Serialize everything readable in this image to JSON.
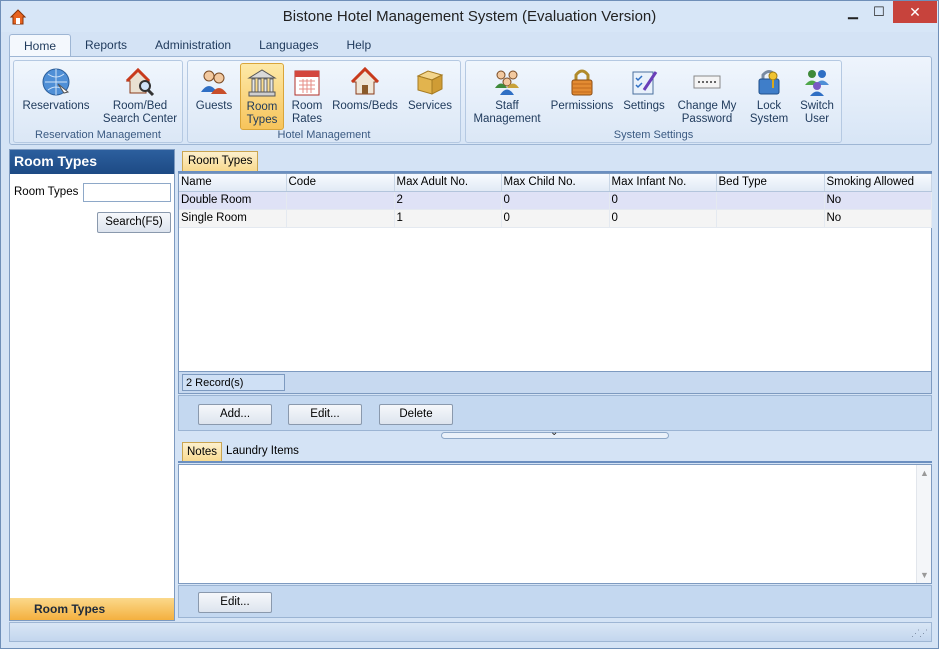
{
  "window": {
    "title": "Bistone Hotel Management System (Evaluation Version)",
    "minimize": "▁",
    "maximize": "☐",
    "close": "✕"
  },
  "ribbon": {
    "tabs": [
      "Home",
      "Reports",
      "Administration",
      "Languages",
      "Help"
    ],
    "groups": {
      "reservation": {
        "label": "Reservation Management",
        "buttons": [
          {
            "label": "Reservations",
            "icon": "globe-icon"
          },
          {
            "label": "Room/Bed Search Center",
            "icon": "house-search-icon"
          }
        ]
      },
      "hotel": {
        "label": "Hotel Management",
        "buttons": [
          {
            "label": "Guests",
            "icon": "people-icon"
          },
          {
            "label": "Room Types",
            "icon": "building-columns-icon"
          },
          {
            "label": "Room Rates",
            "icon": "calendar-icon"
          },
          {
            "label": "Rooms/Beds",
            "icon": "house-icon"
          },
          {
            "label": "Services",
            "icon": "box-icon"
          }
        ]
      },
      "system": {
        "label": "System Settings",
        "buttons": [
          {
            "label": "Staff Management",
            "icon": "staff-icon"
          },
          {
            "label": "Permissions",
            "icon": "padlock-icon"
          },
          {
            "label": "Settings",
            "icon": "settings-checklist-icon"
          },
          {
            "label": "Change My Password",
            "icon": "password-icon"
          },
          {
            "label": "Lock System",
            "icon": "lock-key-icon"
          },
          {
            "label": "Switch User",
            "icon": "switch-user-icon"
          }
        ]
      }
    }
  },
  "leftpanel": {
    "header": "Room Types",
    "field_label": "Room Types",
    "field_value": "",
    "search_button": "Search(F5)",
    "footer": "Room Types"
  },
  "main": {
    "doc_tab": "Room Types",
    "columns": [
      "Name",
      "Code",
      "Max Adult No.",
      "Max Child No.",
      "Max Infant No.",
      "Bed Type",
      "Smoking Allowed"
    ],
    "rows": [
      [
        "Double Room",
        "",
        "2",
        "0",
        "0",
        "",
        "No"
      ],
      [
        "Single Room",
        "",
        "1",
        "0",
        "0",
        "",
        "No"
      ]
    ],
    "record_count": "2 Record(s)",
    "buttons": {
      "add": "Add...",
      "edit": "Edit...",
      "delete": "Delete"
    },
    "bottom_tabs": [
      "Notes",
      "Laundry Items"
    ],
    "notes_edit": "Edit..."
  }
}
